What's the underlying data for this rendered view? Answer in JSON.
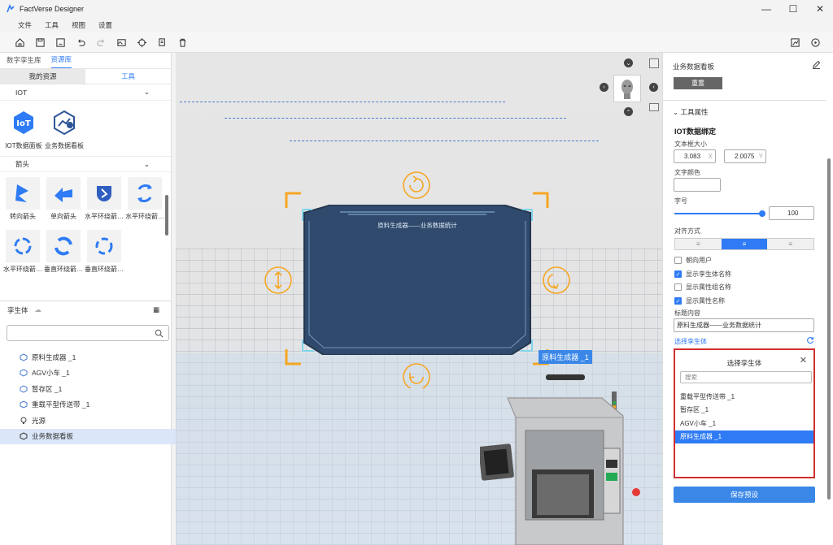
{
  "window": {
    "title": "FactVerse Designer"
  },
  "menu": [
    "文件",
    "工具",
    "视图",
    "设置"
  ],
  "left": {
    "tabs": [
      "数字孪生库",
      "资源库"
    ],
    "subtabs": [
      "我的资源",
      "工具"
    ],
    "sections": {
      "iot": "IOT",
      "arrows": "箭头"
    },
    "iot_tools": [
      "IOT数据面板",
      "业务数据看板"
    ],
    "arrows": [
      "转向箭头",
      "单向箭头",
      "水平环绕箭…",
      "水平环绕箭…",
      "水平环绕箭…",
      "垂直环绕箭…",
      "垂直环绕箭…"
    ],
    "twin_header": "孪生体",
    "tree": [
      "原料生成器 _1",
      "AGV小车 _1",
      "暂存区 _1",
      "重载平型传送带 _1",
      "光源",
      "业务数据看板"
    ]
  },
  "viewport": {
    "board_title": "原料生成器——业务数据统计",
    "tag": "原料生成器 _1"
  },
  "right": {
    "title": "业务数据看板",
    "reset": "重置",
    "tool_attr": "工具属性",
    "iot_bind": "IOT数据绑定",
    "text_box_size": "文本框大小",
    "size_x": "3.083",
    "size_x_unit": "X",
    "size_y": "2.0075",
    "size_y_unit": "Y",
    "text_color": "文字颜色",
    "font_size_label": "字号",
    "font_size": "100",
    "font_size_fraction": 0.96,
    "align_label": "对齐方式",
    "checks": [
      {
        "label": "朝向用户",
        "on": false
      },
      {
        "label": "显示孪生体名称",
        "on": true
      },
      {
        "label": "显示属性组名称",
        "on": false
      },
      {
        "label": "显示属性名称",
        "on": true
      }
    ],
    "title_content_label": "标题内容",
    "title_content": "原料生成器——业务数据统计",
    "select_twin": "选择孪生体",
    "popup": {
      "title": "选择孪生体",
      "search_placeholder": "搜索",
      "items": [
        "重载平型传送带 _1",
        "暂存区 _1",
        "AGV小车 _1",
        "原料生成器 _1"
      ],
      "selected_index": 3
    },
    "save": "保存预设"
  },
  "colors": {
    "accent": "#2f7bf5",
    "board": "#2f4a6c",
    "handles": "#f5a623",
    "alert": "#d32f2f"
  }
}
